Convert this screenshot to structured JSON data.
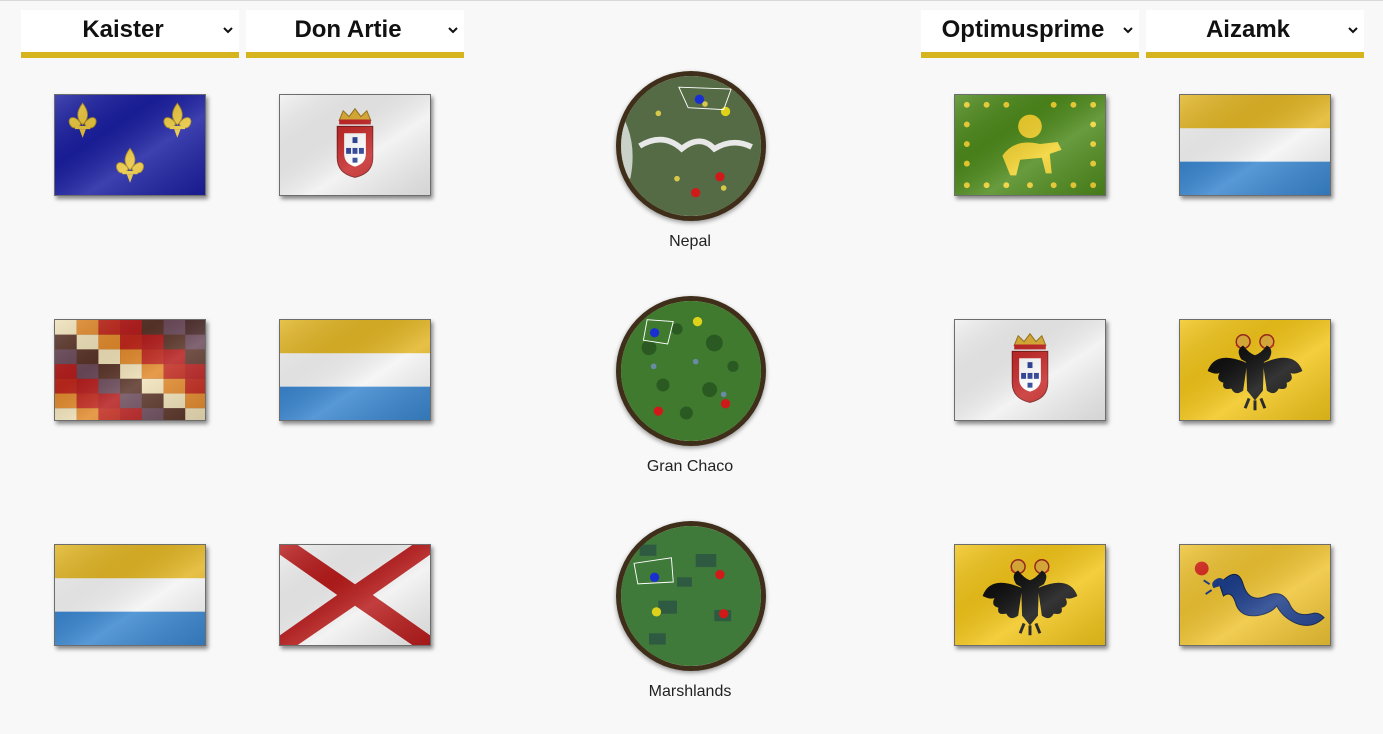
{
  "players": [
    {
      "name": "Kaister",
      "dropdown_icon": "chevron-down-icon"
    },
    {
      "name": "Don Artie",
      "dropdown_icon": "chevron-down-icon"
    },
    {
      "name": "Optimusprime",
      "dropdown_icon": "chevron-down-icon"
    },
    {
      "name": "Aizamk",
      "dropdown_icon": "chevron-down-icon"
    }
  ],
  "rounds": [
    {
      "map": "Nepal",
      "flags": {
        "kaister": "France",
        "don_artie": "Portugal",
        "optimusprime": "Persia",
        "aizamk": "United Provinces"
      }
    },
    {
      "map": "Gran Chaco",
      "flags": {
        "kaister": "Inca",
        "don_artie": "United Provinces",
        "optimusprime": "Portugal",
        "aizamk": "Holy Roman Empire"
      }
    },
    {
      "map": "Marshlands",
      "flags": {
        "kaister": "United Provinces",
        "don_artie": "Spain",
        "optimusprime": "Holy Roman Empire",
        "aizamk": "China"
      }
    }
  ],
  "colors": {
    "accent": "#d6b41e",
    "background": "#f8f8f8",
    "map_rim": "#3f2f1a"
  }
}
